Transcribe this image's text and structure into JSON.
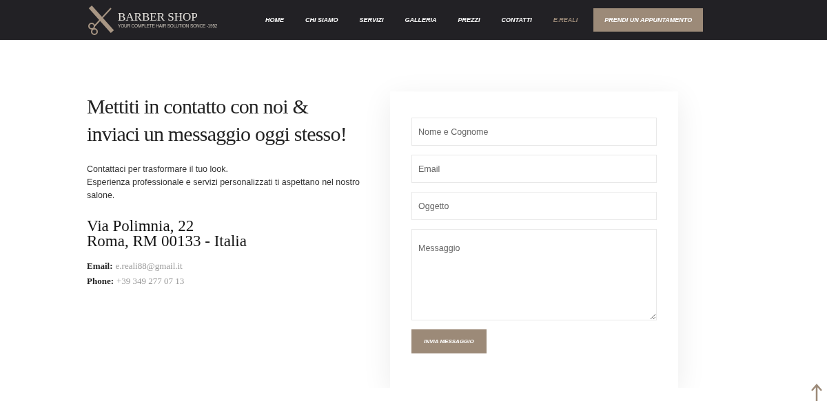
{
  "header": {
    "logo": {
      "title": "BARBER SHOP",
      "tagline": "YOUR COMPLETE HAIR SOLUTION SONCE -1952"
    },
    "nav": [
      {
        "label": "HOME",
        "selected": false
      },
      {
        "label": "CHI SIAMO",
        "selected": false
      },
      {
        "label": "SERVIZI",
        "selected": false
      },
      {
        "label": "GALLERIA",
        "selected": false
      },
      {
        "label": "PREZZI",
        "selected": false
      },
      {
        "label": "CONTATTI",
        "selected": false
      },
      {
        "label": "E.REALI",
        "selected": true
      }
    ],
    "cta": "PRENDI UN APPUNTAMENTO"
  },
  "contact": {
    "heading": "Mettiti in contatto con noi & inviaci un messaggio oggi stesso!",
    "intro": [
      "Contattaci per trasformare il tuo look.",
      "Esperienza professionale e servizi personalizzati ti aspettano nel nostro salone."
    ],
    "address": [
      "Via Polimnia, 22",
      "Roma, RM 00133 - Italia"
    ],
    "details": [
      {
        "label": "Email:",
        "value": "e.reali88@gmail.it"
      },
      {
        "label": "Phone:",
        "value": "+39 349 277 07 13"
      }
    ]
  },
  "form": {
    "fields": [
      {
        "kind": "input",
        "placeholder": "Nome e Cognome"
      },
      {
        "kind": "input",
        "placeholder": "Email"
      },
      {
        "kind": "input",
        "placeholder": "Oggetto"
      },
      {
        "kind": "textarea",
        "placeholder": "Messaggio"
      }
    ],
    "submit": "INVIA MESSAGGIO"
  }
}
